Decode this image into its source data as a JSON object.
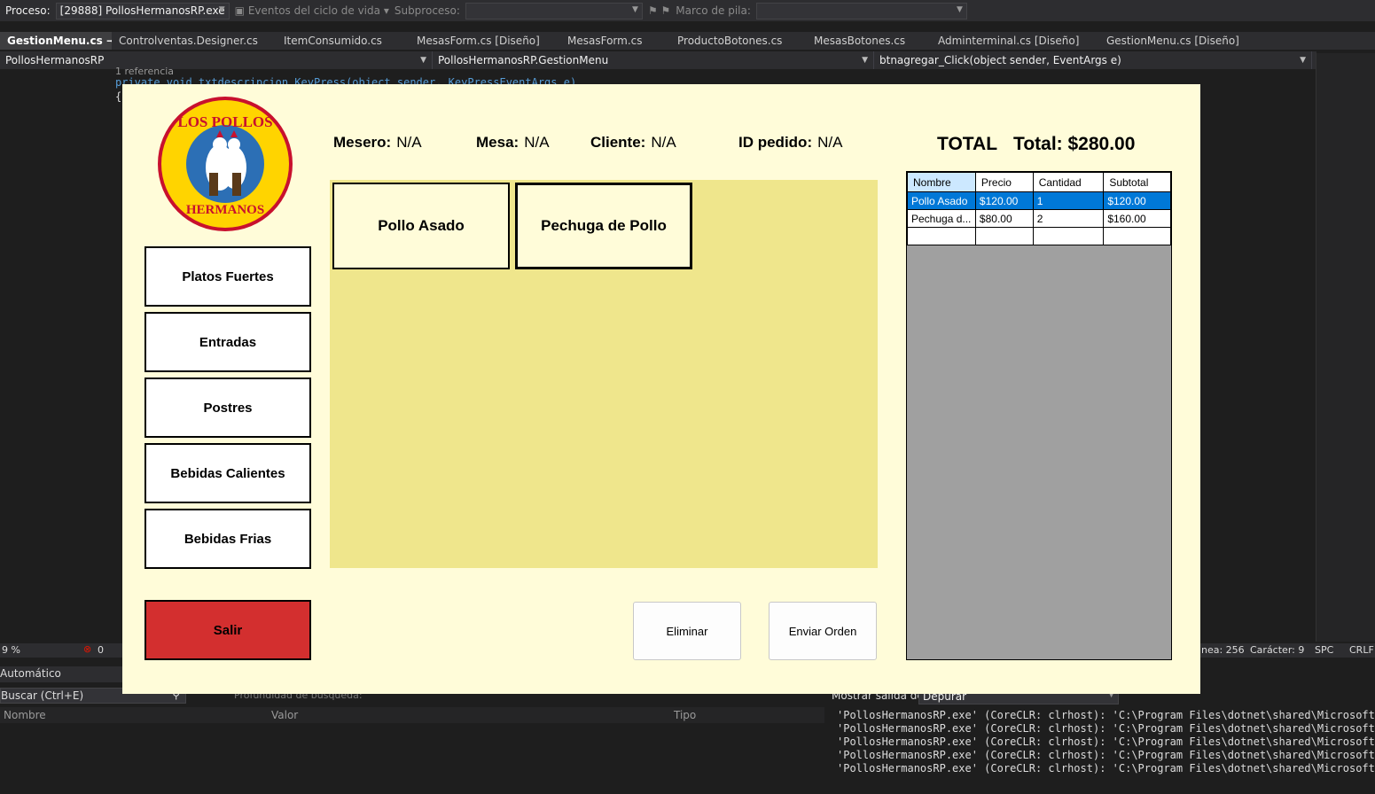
{
  "vs": {
    "toolbar": {
      "process_label": "Proceso:",
      "process_value": "[29888] PollosHermanosRP.exe",
      "lifecycle_label": "Eventos del ciclo de vida",
      "thread_label": "Subproceso:",
      "stack_label": "Marco de pila:"
    },
    "tabs": [
      "GestionMenu.cs",
      "Controlventas.Designer.cs",
      "ItemConsumido.cs",
      "MesasForm.cs [Diseño]",
      "MesasForm.cs",
      "ProductoBotones.cs",
      "MesasBotones.cs",
      "Adminterminal.cs [Diseño]",
      "GestionMenu.cs [Diseño]"
    ],
    "navbar": {
      "project": "PollosHermanosRP",
      "class": "PollosHermanosRP.GestionMenu",
      "member": "btnagregar_Click(object sender, EventArgs e)"
    },
    "code": {
      "reference": "1 referencia",
      "line1": "private void txtdescripcion_KeyPress(object sender, KeyPressEventArgs e)",
      "brace": "{"
    },
    "status": {
      "zoom": "9 %",
      "errors": "0",
      "line": "nea: 256",
      "char": "Carácter: 9",
      "spc": "SPC",
      "crlf": "CRLF"
    },
    "autos": {
      "title": "Automático",
      "search": "Buscar (Ctrl+E)",
      "depth": "Profundidad de búsqueda:",
      "col_name": "Nombre",
      "col_value": "Valor",
      "col_type": "Tipo"
    },
    "output": {
      "show_from": "Mostrar salida de:",
      "source": "Depurar",
      "lines": [
        "'PollosHermanosRP.exe' (CoreCLR: clrhost): 'C:\\Program Files\\dotnet\\shared\\Microsoft.NE",
        "'PollosHermanosRP.exe' (CoreCLR: clrhost): 'C:\\Program Files\\dotnet\\shared\\Microsoft.NE",
        "'PollosHermanosRP.exe' (CoreCLR: clrhost): 'C:\\Program Files\\dotnet\\shared\\Microsoft.NE",
        "'PollosHermanosRP.exe' (CoreCLR: clrhost): 'C:\\Program Files\\dotnet\\shared\\Microsoft.NE",
        "'PollosHermanosRP.exe' (CoreCLR: clrhost): 'C:\\Program Files\\dotnet\\shared\\Microsoft.NE"
      ]
    }
  },
  "app": {
    "logo": {
      "top": "LOS POLLOS",
      "bottom": "HERMANOS"
    },
    "categories": [
      "Platos Fuertes",
      "Entradas",
      "Postres",
      "Bebidas Calientes",
      "Bebidas Frias"
    ],
    "exit_label": "Salir",
    "info": {
      "mesero_label": "Mesero:",
      "mesero_value": "N/A",
      "mesa_label": "Mesa:",
      "mesa_value": "N/A",
      "cliente_label": "Cliente:",
      "cliente_value": "N/A",
      "pedido_label": "ID pedido:",
      "pedido_value": "N/A"
    },
    "total": {
      "label": "TOTAL",
      "value": "Total: $280.00"
    },
    "products": [
      "Pollo Asado",
      "Pechuga de Pollo"
    ],
    "actions": {
      "delete": "Eliminar",
      "send": "Enviar Orden"
    },
    "grid": {
      "columns": [
        "Nombre",
        "Precio",
        "Cantidad",
        "Subtotal"
      ],
      "rows": [
        [
          "Pollo Asado",
          "$120.00",
          "1",
          "$120.00"
        ],
        [
          "Pechuga d...",
          "$80.00",
          "2",
          "$160.00"
        ],
        [
          "",
          "",
          "",
          ""
        ]
      ]
    },
    "colors": {
      "background": "#fffcd9",
      "products_panel": "#efe68c",
      "exit": "#d32f2f",
      "selected_row": "#0078d7",
      "grid_empty": "#a0a0a0"
    }
  }
}
